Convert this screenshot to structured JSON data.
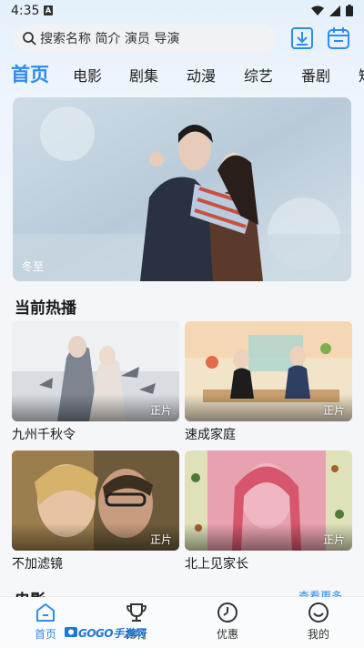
{
  "status_bar": {
    "time": "4:35",
    "notification": "A"
  },
  "search": {
    "placeholder": "搜索名称 简介 演员 导演"
  },
  "header_icons": [
    "download-icon",
    "calendar-icon"
  ],
  "tabs": [
    {
      "label": "首页",
      "active": true
    },
    {
      "label": "电影"
    },
    {
      "label": "剧集"
    },
    {
      "label": "动漫"
    },
    {
      "label": "综艺"
    },
    {
      "label": "番剧"
    },
    {
      "label": "短"
    }
  ],
  "banner": {
    "label": "冬至"
  },
  "section_hot": {
    "title": "当前热播",
    "items": [
      {
        "title": "九州千秋令",
        "badge": "正片"
      },
      {
        "title": "速成家庭",
        "badge": "正片"
      },
      {
        "title": "不加滤镜",
        "badge": "正片"
      },
      {
        "title": "北上见家长",
        "badge": "正片"
      }
    ]
  },
  "section_movie": {
    "title": "电影",
    "more": "查看更多"
  },
  "bottom_nav": [
    {
      "label": "首页",
      "icon": "home-icon",
      "active": true
    },
    {
      "label": "排行",
      "icon": "trophy-icon"
    },
    {
      "label": "优惠",
      "icon": "clock-icon"
    },
    {
      "label": "我的",
      "icon": "smiley-icon"
    }
  ],
  "watermark": {
    "text": "GOGO手游网"
  },
  "colors": {
    "accent": "#2d8cf0"
  }
}
